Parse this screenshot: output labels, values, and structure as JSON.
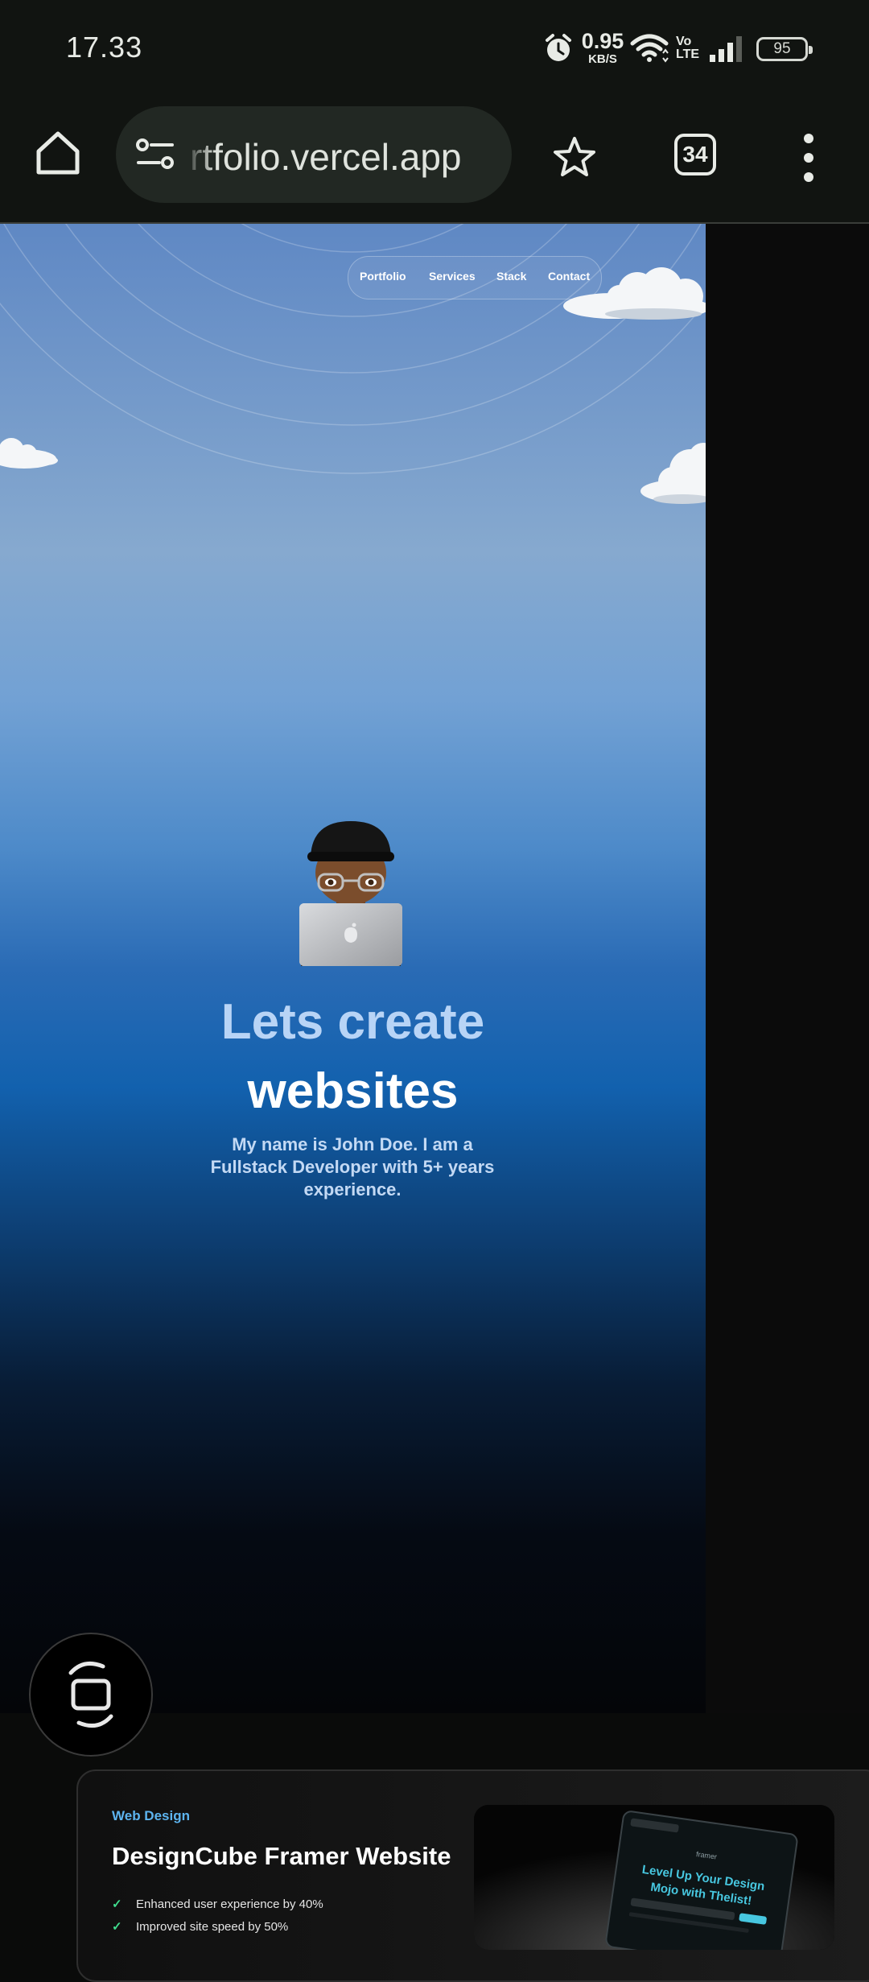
{
  "status_bar": {
    "time": "17.33",
    "net_speed_value": "0.95",
    "net_speed_unit": "KB/S",
    "volte_line1": "Vo",
    "volte_line2": "LTE",
    "battery": "95"
  },
  "browser": {
    "url": "rtfolio.vercel.app",
    "tab_count": "34"
  },
  "site": {
    "nav": [
      "Portfolio",
      "Services",
      "Stack",
      "Contact"
    ],
    "hero_line1": "Lets create",
    "hero_line2": "websites",
    "hero_subtitle": "My name is John Doe. I am a Fullstack Developer with 5+ years experience."
  },
  "project_card": {
    "tag": "Web Design",
    "title": "DesignCube Framer Website",
    "features": [
      "Enhanced user experience by 40%",
      "Improved site speed by 50%"
    ],
    "preview_brand": "framer",
    "preview_headline_1": "Level Up Your Design",
    "preview_headline_2": "Mojo with Thelist!"
  },
  "colors": {
    "accent_blue": "#5db4ef",
    "check_green": "#3fdc8d",
    "hero_light": "#b8d4f6"
  },
  "icons": [
    "home-icon",
    "site-info-icon",
    "star-icon",
    "tabs-icon",
    "more-vert-icon",
    "alarm-icon",
    "wifi-icon",
    "signal-icon",
    "battery-icon",
    "rotate-icon",
    "check-icon"
  ]
}
